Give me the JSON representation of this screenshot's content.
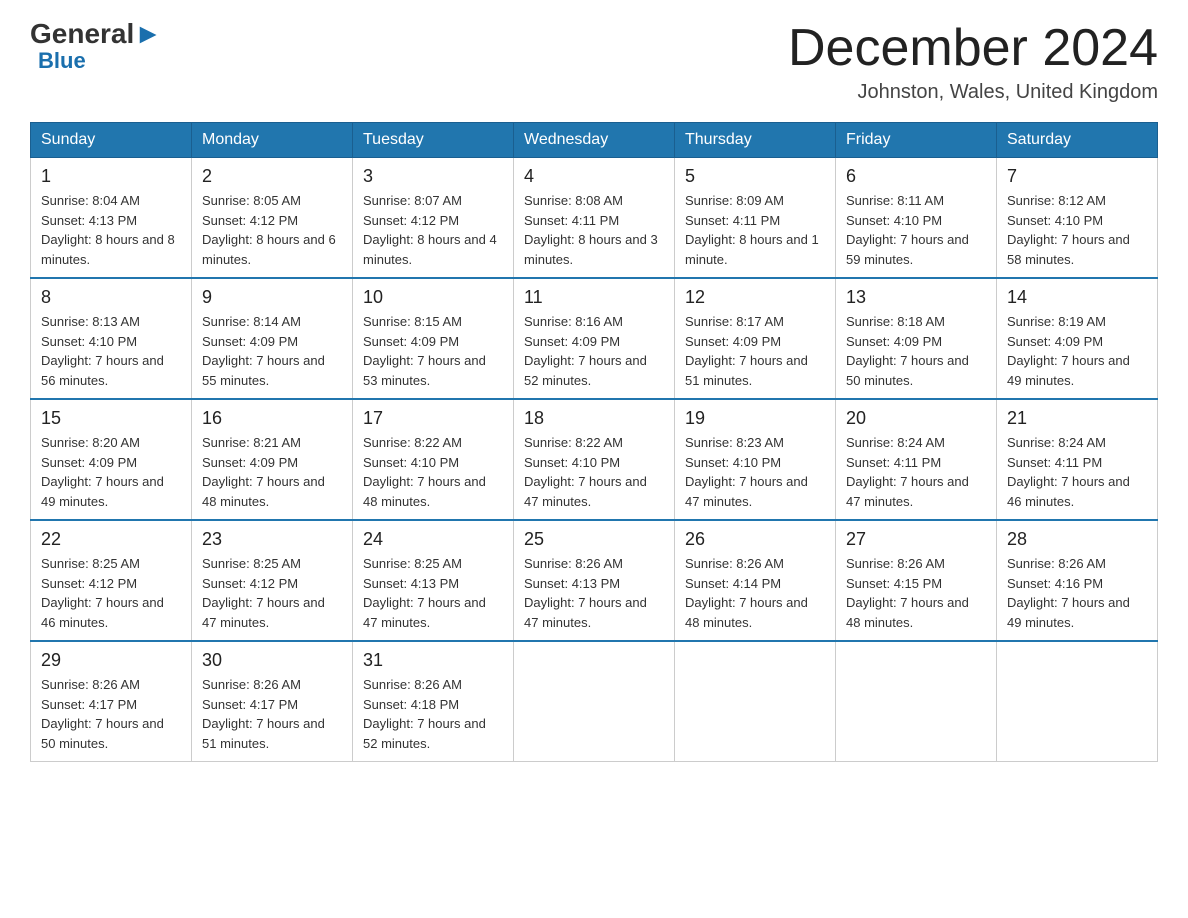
{
  "header": {
    "logo_text_general": "General",
    "logo_text_blue": "Blue",
    "month_title": "December 2024",
    "location": "Johnston, Wales, United Kingdom"
  },
  "days_of_week": [
    "Sunday",
    "Monday",
    "Tuesday",
    "Wednesday",
    "Thursday",
    "Friday",
    "Saturday"
  ],
  "weeks": [
    [
      {
        "day": "1",
        "sunrise": "8:04 AM",
        "sunset": "4:13 PM",
        "daylight": "8 hours and 8 minutes."
      },
      {
        "day": "2",
        "sunrise": "8:05 AM",
        "sunset": "4:12 PM",
        "daylight": "8 hours and 6 minutes."
      },
      {
        "day": "3",
        "sunrise": "8:07 AM",
        "sunset": "4:12 PM",
        "daylight": "8 hours and 4 minutes."
      },
      {
        "day": "4",
        "sunrise": "8:08 AM",
        "sunset": "4:11 PM",
        "daylight": "8 hours and 3 minutes."
      },
      {
        "day": "5",
        "sunrise": "8:09 AM",
        "sunset": "4:11 PM",
        "daylight": "8 hours and 1 minute."
      },
      {
        "day": "6",
        "sunrise": "8:11 AM",
        "sunset": "4:10 PM",
        "daylight": "7 hours and 59 minutes."
      },
      {
        "day": "7",
        "sunrise": "8:12 AM",
        "sunset": "4:10 PM",
        "daylight": "7 hours and 58 minutes."
      }
    ],
    [
      {
        "day": "8",
        "sunrise": "8:13 AM",
        "sunset": "4:10 PM",
        "daylight": "7 hours and 56 minutes."
      },
      {
        "day": "9",
        "sunrise": "8:14 AM",
        "sunset": "4:09 PM",
        "daylight": "7 hours and 55 minutes."
      },
      {
        "day": "10",
        "sunrise": "8:15 AM",
        "sunset": "4:09 PM",
        "daylight": "7 hours and 53 minutes."
      },
      {
        "day": "11",
        "sunrise": "8:16 AM",
        "sunset": "4:09 PM",
        "daylight": "7 hours and 52 minutes."
      },
      {
        "day": "12",
        "sunrise": "8:17 AM",
        "sunset": "4:09 PM",
        "daylight": "7 hours and 51 minutes."
      },
      {
        "day": "13",
        "sunrise": "8:18 AM",
        "sunset": "4:09 PM",
        "daylight": "7 hours and 50 minutes."
      },
      {
        "day": "14",
        "sunrise": "8:19 AM",
        "sunset": "4:09 PM",
        "daylight": "7 hours and 49 minutes."
      }
    ],
    [
      {
        "day": "15",
        "sunrise": "8:20 AM",
        "sunset": "4:09 PM",
        "daylight": "7 hours and 49 minutes."
      },
      {
        "day": "16",
        "sunrise": "8:21 AM",
        "sunset": "4:09 PM",
        "daylight": "7 hours and 48 minutes."
      },
      {
        "day": "17",
        "sunrise": "8:22 AM",
        "sunset": "4:10 PM",
        "daylight": "7 hours and 48 minutes."
      },
      {
        "day": "18",
        "sunrise": "8:22 AM",
        "sunset": "4:10 PM",
        "daylight": "7 hours and 47 minutes."
      },
      {
        "day": "19",
        "sunrise": "8:23 AM",
        "sunset": "4:10 PM",
        "daylight": "7 hours and 47 minutes."
      },
      {
        "day": "20",
        "sunrise": "8:24 AM",
        "sunset": "4:11 PM",
        "daylight": "7 hours and 47 minutes."
      },
      {
        "day": "21",
        "sunrise": "8:24 AM",
        "sunset": "4:11 PM",
        "daylight": "7 hours and 46 minutes."
      }
    ],
    [
      {
        "day": "22",
        "sunrise": "8:25 AM",
        "sunset": "4:12 PM",
        "daylight": "7 hours and 46 minutes."
      },
      {
        "day": "23",
        "sunrise": "8:25 AM",
        "sunset": "4:12 PM",
        "daylight": "7 hours and 47 minutes."
      },
      {
        "day": "24",
        "sunrise": "8:25 AM",
        "sunset": "4:13 PM",
        "daylight": "7 hours and 47 minutes."
      },
      {
        "day": "25",
        "sunrise": "8:26 AM",
        "sunset": "4:13 PM",
        "daylight": "7 hours and 47 minutes."
      },
      {
        "day": "26",
        "sunrise": "8:26 AM",
        "sunset": "4:14 PM",
        "daylight": "7 hours and 48 minutes."
      },
      {
        "day": "27",
        "sunrise": "8:26 AM",
        "sunset": "4:15 PM",
        "daylight": "7 hours and 48 minutes."
      },
      {
        "day": "28",
        "sunrise": "8:26 AM",
        "sunset": "4:16 PM",
        "daylight": "7 hours and 49 minutes."
      }
    ],
    [
      {
        "day": "29",
        "sunrise": "8:26 AM",
        "sunset": "4:17 PM",
        "daylight": "7 hours and 50 minutes."
      },
      {
        "day": "30",
        "sunrise": "8:26 AM",
        "sunset": "4:17 PM",
        "daylight": "7 hours and 51 minutes."
      },
      {
        "day": "31",
        "sunrise": "8:26 AM",
        "sunset": "4:18 PM",
        "daylight": "7 hours and 52 minutes."
      },
      null,
      null,
      null,
      null
    ]
  ]
}
